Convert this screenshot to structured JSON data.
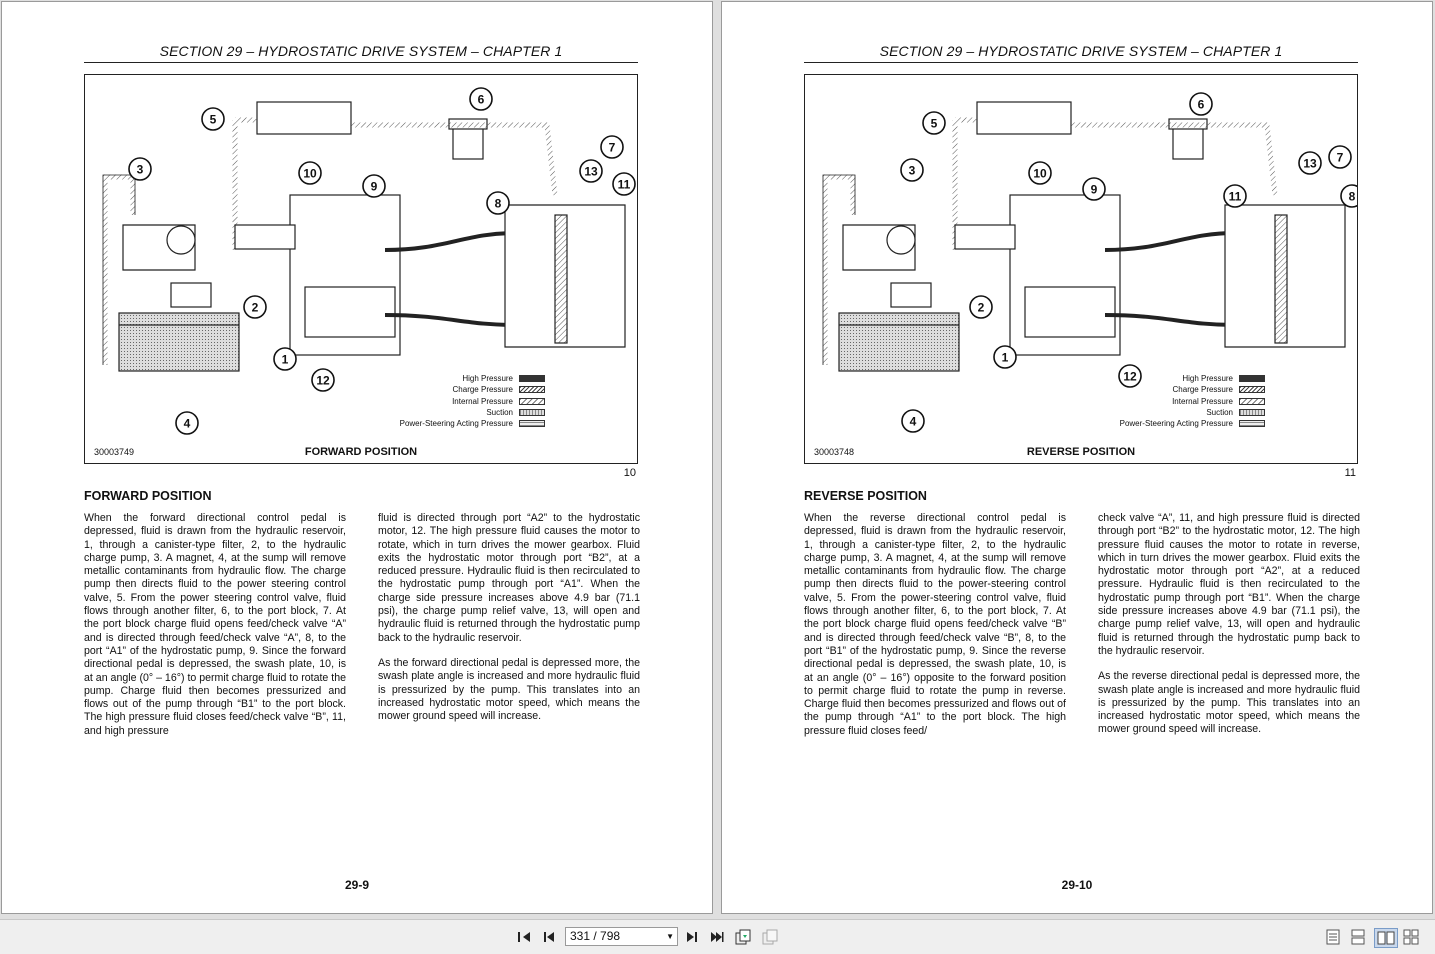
{
  "header_text": "SECTION 29 – HYDROSTATIC DRIVE SYSTEM – CHAPTER 1",
  "legend": [
    "High Pressure",
    "Charge Pressure",
    "Internal Pressure",
    "Suction",
    "Power-Steering Acting Pressure"
  ],
  "left_page": {
    "figure_id": "30003749",
    "figure_caption": "FORWARD POSITION",
    "figure_number": "10",
    "callouts": [
      "1",
      "2",
      "3",
      "4",
      "5",
      "6",
      "7",
      "8",
      "9",
      "10",
      "11",
      "12",
      "13"
    ],
    "section_title": "FORWARD POSITION",
    "col1": "When the forward directional control pedal is depressed, fluid is drawn from the hydraulic reservoir, 1, through a canister-type filter, 2, to the hydraulic charge pump, 3. A magnet, 4, at the sump will remove metallic contaminants from hydraulic flow. The charge pump then directs fluid to the power steering control valve, 5. From the power steering control valve, fluid flows through another filter, 6, to the port block, 7. At the port block charge fluid opens feed/check valve “A” and is directed through feed/check valve “A”, 8, to the port “A1” of the hydrostatic pump, 9. Since the forward directional pedal is depressed, the swash plate, 10, is at an angle (0° – 16°) to permit charge fluid to rotate the pump. Charge fluid then becomes pressurized and flows out of the pump through “B1” to the port block. The high pressure fluid closes feed/check valve “B”, 11, and high pressure",
    "col2_p1": "fluid is directed through port “A2” to the hydrostatic motor, 12. The high pressure fluid causes the motor to rotate, which in turn drives the mower gearbox. Fluid exits the hydrostatic motor through port “B2”, at a reduced pressure. Hydraulic fluid is then recirculated to the hydrostatic pump through port “A1”. When the charge side pressure increases above 4.9 bar (71.1 psi), the charge pump relief valve, 13, will open and hydraulic fluid is returned through the hydrostatic pump back to the hydraulic reservoir.",
    "col2_p2": "As the forward directional pedal is depressed more, the swash plate angle is increased and more hydraulic fluid is pressurized by the pump. This translates into an increased hydrostatic motor speed, which means the mower ground speed will increase.",
    "page_number": "29-9"
  },
  "right_page": {
    "figure_id": "30003748",
    "figure_caption": "REVERSE POSITION",
    "figure_number": "11",
    "callouts": [
      "1",
      "2",
      "3",
      "4",
      "5",
      "6",
      "7",
      "8",
      "9",
      "10",
      "11",
      "12",
      "13"
    ],
    "section_title": "REVERSE POSITION",
    "col1": "When the reverse directional control pedal is depressed, fluid is drawn from the hydraulic reservoir, 1, through a canister-type filter, 2, to the hydraulic charge pump, 3. A magnet, 4, at the sump will remove metallic contaminants from hydraulic flow. The charge pump then directs fluid to the power-steering control valve, 5. From the power-steering control valve, fluid flows through another filter, 6, to the port block, 7. At the port block charge fluid opens feed/check valve “B” and is directed through feed/check valve “B”, 8, to the port “B1” of the hydrostatic pump, 9. Since the reverse directional pedal is depressed, the swash plate, 10, is at an angle (0° – 16°) opposite to the forward position to permit charge fluid to rotate the pump in reverse. Charge fluid then becomes pressurized and flows out of the pump through “A1” to the port block. The high pressure fluid closes feed/",
    "col2_p1": "check valve “A”, 11, and high pressure fluid is directed through port “B2” to the hydrostatic motor, 12. The high pressure fluid causes the motor to rotate in reverse, which in turn drives the mower gearbox. Fluid exits the hydrostatic motor through port “A2”, at a reduced pressure. Hydraulic fluid is then recirculated to the hydrostatic pump through port “B1”. When the charge side pressure increases above 4.9 bar (71.1 psi), the charge pump relief valve, 13, will open and hydraulic fluid is returned through the hydrostatic pump back to the hydraulic reservoir.",
    "col2_p2": "As the reverse directional pedal is depressed more, the swash plate angle is increased and more hydraulic fluid is pressurized by the pump. This translates into an increased hydrostatic motor speed, which means the mower ground speed will increase.",
    "page_number": "29-10"
  },
  "toolbar": {
    "page_indicator": "331 / 798",
    "icons": [
      "first-page-icon",
      "prev-page-icon",
      "next-page-icon",
      "last-page-icon",
      "rotate-icon",
      "view-mode-icon",
      "single-page-icon",
      "continuous-icon",
      "two-page-icon",
      "two-page-continuous-icon"
    ]
  }
}
